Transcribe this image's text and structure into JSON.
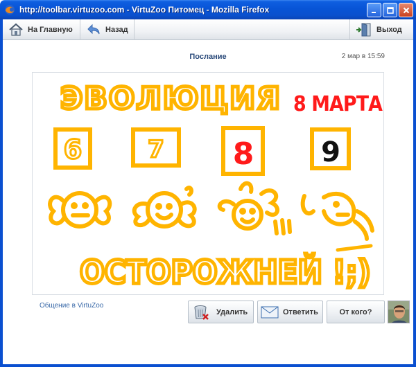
{
  "window": {
    "title": "http://toolbar.virtuzoo.com - VirtuZoo Питомец - Mozilla Firefox",
    "icon": "firefox-icon"
  },
  "toolbar": {
    "home_label": "На Главную",
    "back_label": "Назад",
    "exit_label": "Выход",
    "home_icon": "house-icon",
    "back_icon": "back-arrow-icon",
    "exit_icon": "door-exit-icon"
  },
  "message": {
    "title": "Послание",
    "date": "2 мар в 15:59"
  },
  "drawing": {
    "heading": "ЭВОЛЮЦИЯ",
    "date_note": "8 МАРТА",
    "numbers": [
      "6",
      "7",
      "8",
      "9"
    ],
    "caption": "ОСТОРОЖНЕЙ !;)",
    "colors": {
      "orange": "#ffb400",
      "red": "#ff1a1a",
      "black": "#111111"
    }
  },
  "footer": {
    "link_label": "Общение в VirtuZoo"
  },
  "actions": {
    "delete_label": "Удалить",
    "reply_label": "Ответить",
    "from_label": "От кого?",
    "delete_icon": "trash-icon",
    "reply_icon": "envelope-icon"
  },
  "sender": {
    "avatar_icon": "user-photo"
  }
}
